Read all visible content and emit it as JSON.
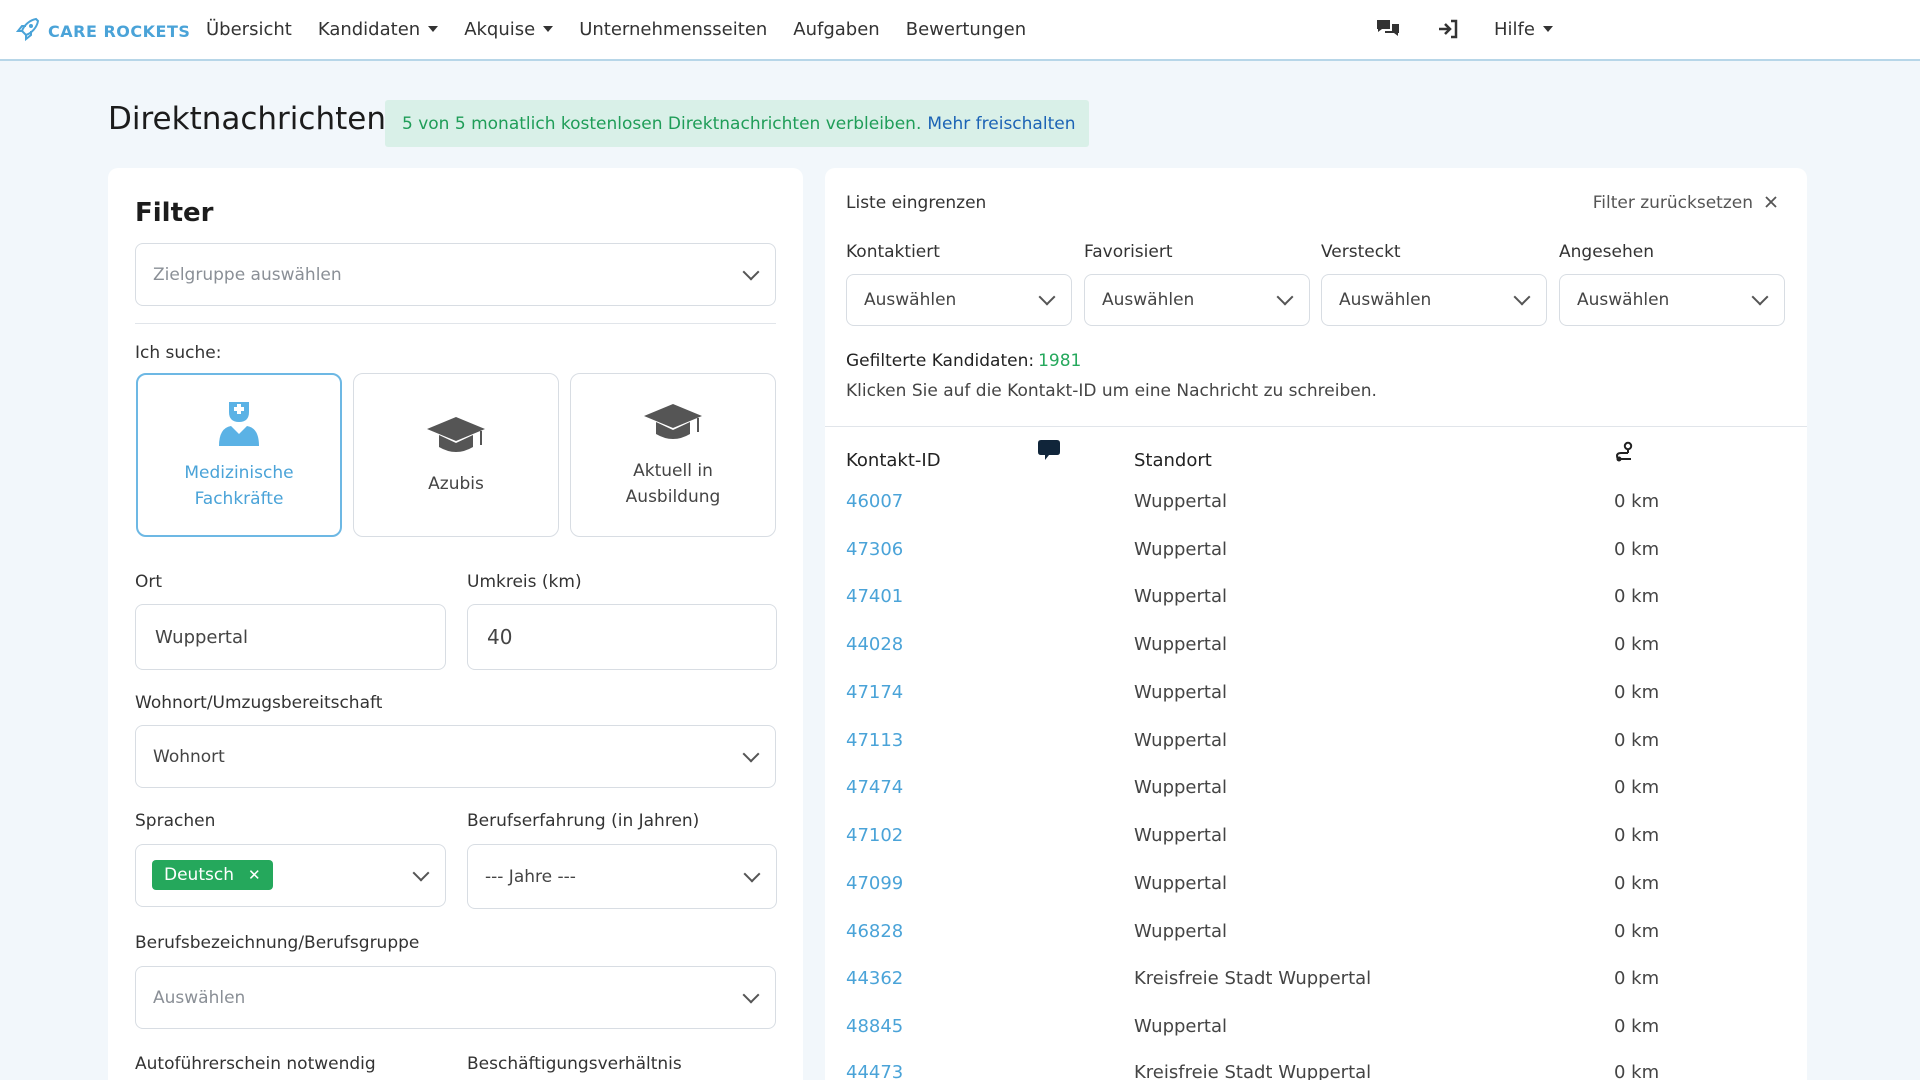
{
  "brand": {
    "name": "CARE ROCKETS",
    "color": "#4aa3d8"
  },
  "nav": {
    "items": [
      {
        "label": "Übersicht",
        "dropdown": false
      },
      {
        "label": "Kandidaten",
        "dropdown": true
      },
      {
        "label": "Akquise",
        "dropdown": true
      },
      {
        "label": "Unternehmensseiten",
        "dropdown": false
      },
      {
        "label": "Aufgaben",
        "dropdown": false
      },
      {
        "label": "Bewertungen",
        "dropdown": false
      }
    ],
    "icons": [
      "chat-icon",
      "sign-in-icon"
    ],
    "help_label": "Hilfe"
  },
  "header": {
    "title": "Direktnachrichten",
    "banner_text": "5 von 5 monatlich kostenlosen Direktnachrichten verbleiben.",
    "banner_link": "Mehr freischalten"
  },
  "filter": {
    "title": "Filter",
    "target_group_placeholder": "Zielgruppe auswählen",
    "searching_label": "Ich suche:",
    "segments": [
      {
        "label_line1": "Medizinische",
        "label_line2": "Fachkräfte",
        "icon": "medical-staff-icon",
        "active": true
      },
      {
        "label_line1": "Azubis",
        "label_line2": "",
        "icon": "graduation-cap-icon",
        "active": false
      },
      {
        "label_line1": "Aktuell in",
        "label_line2": "Ausbildung",
        "icon": "graduation-cap-icon",
        "active": false
      }
    ],
    "location_label": "Ort",
    "location_value": "Wuppertal",
    "radius_label": "Umkreis (km)",
    "radius_value": "40",
    "residence_label": "Wohnort/Umzugsbereitschaft",
    "residence_value": "Wohnort",
    "languages_label": "Sprachen",
    "language_tag": "Deutsch",
    "experience_label": "Berufserfahrung (in Jahren)",
    "experience_value": "--- Jahre ---",
    "profession_label": "Berufsbezeichnung/Berufsgruppe",
    "profession_placeholder": "Auswählen",
    "license_label": "Autoführerschein notwendig",
    "employment_label": "Beschäftigungsverhältnis"
  },
  "list": {
    "narrow_label": "Liste eingrenzen",
    "reset_label": "Filter zurücksetzen",
    "filters": [
      {
        "label": "Kontaktiert",
        "value": "Auswählen"
      },
      {
        "label": "Favorisiert",
        "value": "Auswählen"
      },
      {
        "label": "Versteckt",
        "value": "Auswählen"
      },
      {
        "label": "Angesehen",
        "value": "Auswählen"
      }
    ],
    "count_label": "Gefilterte Kandidaten:",
    "count_value": "1981",
    "hint": "Klicken Sie auf die Kontakt-ID um eine Nachricht zu schreiben.",
    "columns": {
      "id": "Kontakt-ID",
      "location": "Standort"
    },
    "rows": [
      {
        "id": "46007",
        "location": "Wuppertal",
        "distance": "0 km"
      },
      {
        "id": "47306",
        "location": "Wuppertal",
        "distance": "0 km"
      },
      {
        "id": "47401",
        "location": "Wuppertal",
        "distance": "0 km"
      },
      {
        "id": "44028",
        "location": "Wuppertal",
        "distance": "0 km"
      },
      {
        "id": "47174",
        "location": "Wuppertal",
        "distance": "0 km"
      },
      {
        "id": "47113",
        "location": "Wuppertal",
        "distance": "0 km"
      },
      {
        "id": "47474",
        "location": "Wuppertal",
        "distance": "0 km"
      },
      {
        "id": "47102",
        "location": "Wuppertal",
        "distance": "0 km"
      },
      {
        "id": "47099",
        "location": "Wuppertal",
        "distance": "0 km"
      },
      {
        "id": "46828",
        "location": "Wuppertal",
        "distance": "0 km"
      },
      {
        "id": "44362",
        "location": "Kreisfreie Stadt Wuppertal",
        "distance": "0 km"
      },
      {
        "id": "48845",
        "location": "Wuppertal",
        "distance": "0 km"
      },
      {
        "id": "44473",
        "location": "Kreisfreie Stadt Wuppertal",
        "distance": "0 km"
      }
    ]
  }
}
